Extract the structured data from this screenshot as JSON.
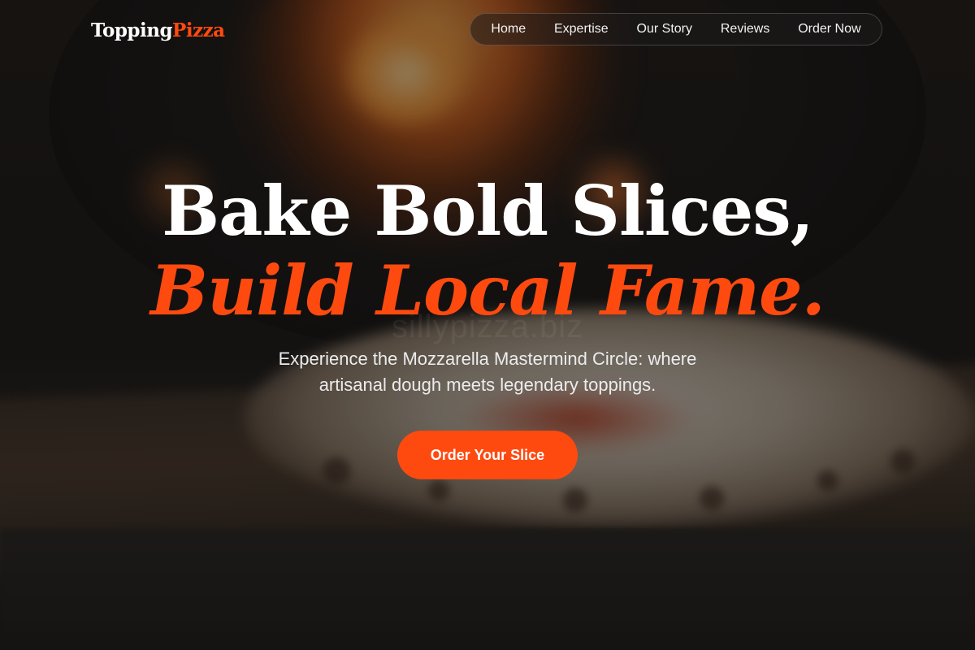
{
  "brand": {
    "name_part1": "Topping",
    "name_part2": "Pizza",
    "accent_color": "#ff4a0f"
  },
  "nav": {
    "items": [
      {
        "label": "Home"
      },
      {
        "label": "Expertise"
      },
      {
        "label": "Our Story"
      },
      {
        "label": "Reviews"
      },
      {
        "label": "Order Now"
      }
    ]
  },
  "hero": {
    "headline_line1": "Bake Bold Slices,",
    "headline_line2": "Build Local Fame.",
    "subtitle_line1": "Experience the Mozzarella Mastermind Circle: where",
    "subtitle_line2": "artisanal dough meets legendary toppings.",
    "cta_label": "Order Your Slice",
    "watermark": "sillypizza.biz"
  }
}
